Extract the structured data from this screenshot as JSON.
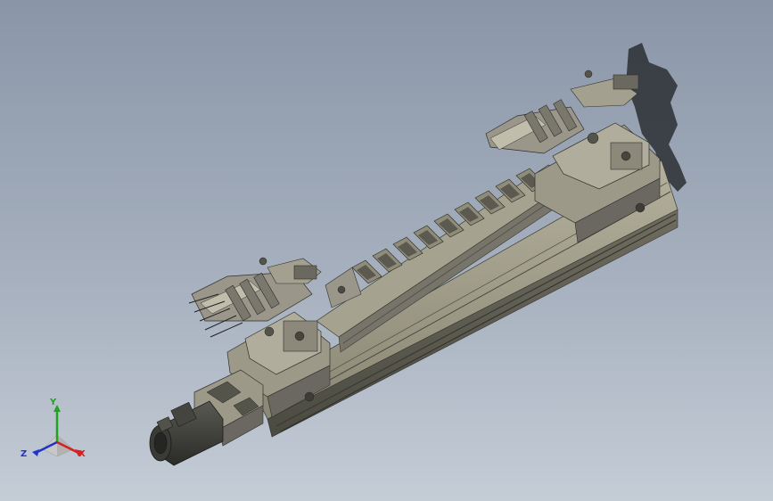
{
  "viewport": {
    "background_top": "#8a96a8",
    "background_bottom": "#c4ccd6"
  },
  "model": {
    "description_icon": "linear-axis-module-icon",
    "body_color": "#8f8c7a",
    "dark_color": "#4a4a44",
    "motor_color": "#3a3a36"
  },
  "triad": {
    "x_label": "X",
    "y_label": "Y",
    "z_label": "Z",
    "x_color": "#d42020",
    "y_color": "#1fa41f",
    "z_color": "#2035c8"
  }
}
